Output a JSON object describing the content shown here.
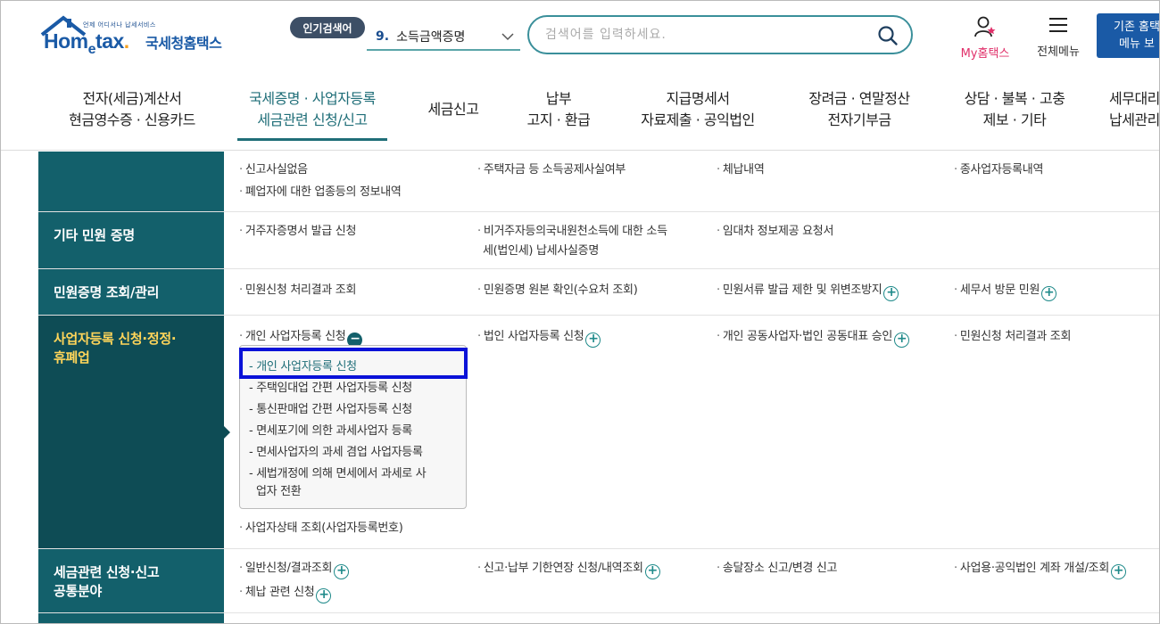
{
  "header": {
    "logo_tagline": "언제 어디서나 납세서비스",
    "logo_word_1": "Hom",
    "logo_word_e": "e",
    "logo_word_2": "tax",
    "logo_word_dot": ".",
    "logo_name": "국세청홈택스",
    "popular_badge": "인기검색어",
    "popular_rank": "9.",
    "popular_term": "소득금액증명",
    "search_placeholder": "검색어를 입력하세요.",
    "my_hometax": "My홈택스",
    "all_menu": "전체메뉴",
    "old_button_line1": "기존 홈택",
    "old_button_line2": "메뉴 보"
  },
  "gnb": [
    {
      "line1": "전자(세금)계산서",
      "line2": "현금영수증 · 신용카드"
    },
    {
      "line1": "국세증명 · 사업자등록",
      "line2": "세금관련 신청/신고"
    },
    {
      "line1": "세금신고",
      "line2": ""
    },
    {
      "line1": "납부",
      "line2": "고지 · 환급"
    },
    {
      "line1": "지급명세서",
      "line2": "자료제출 · 공익법인"
    },
    {
      "line1": "장려금 · 연말정산",
      "line2": "전자기부금"
    },
    {
      "line1": "상담 · 불복 · 고충",
      "line2": "제보 · 기타"
    },
    {
      "line1": "세무대리",
      "line2": "납세관리"
    }
  ],
  "rows": {
    "top": {
      "c1a": "신고사실없음",
      "c1b": "폐업자에 대한 업종등의 정보내역",
      "c2": "주택자금 등 소득공제사실여부",
      "c3": "체납내역",
      "c4": "종사업자등록내역"
    },
    "etc": {
      "title": "기타 민원 증명",
      "c1": "거주자증명서 발급 신청",
      "c2a": "비거주자등의국내원천소득에 대한 소득",
      "c2b": "세(법인세) 납세사실증명",
      "c3": "임대차 정보제공 요청서"
    },
    "manage": {
      "title": "민원증명 조회/관리",
      "c1": "민원신청 처리결과 조회",
      "c2": "민원증명 원본 확인(수요처 조회)",
      "c3": "민원서류 발급 제한 및 위변조방지",
      "c4": "세무서 방문 민원"
    },
    "bizreg": {
      "title_1": "사업자등록 신청·정정·",
      "title_2": "휴폐업",
      "c1": "개인 사업자등록 신청",
      "c2": "법인 사업자등록 신청",
      "c3": "개인 공동사업자·법인 공동대표 승인",
      "c4": "민원신청 처리결과 조회",
      "c5": "사업자상태 조회(사업자등록번호)",
      "submenu": [
        "개인 사업자등록 신청",
        "주택임대업 간편 사업자등록 신청",
        "통신판매업 간편 사업자등록 신청",
        "면세포기에 의한 과세사업자 등록",
        "면세사업자의 과세 겸업 사업자등록",
        "세법개정에 의해 면세에서 과세로 사",
        "업자 전환"
      ]
    },
    "common": {
      "title_1": "세금관련 신청·신고",
      "title_2": "공통분야",
      "c1": "일반신청/결과조회",
      "c1b": "체납 관련 신청",
      "c2": "신고·납부 기한연장 신청/내역조회",
      "c3": "송달장소 신고/변경 신고",
      "c4": "사업용·공익법인 계좌 개설/조회"
    }
  },
  "colors": {
    "brand_blue": "#1a5aa6",
    "teal": "#13606b",
    "active_head": "#0e4c55",
    "active_text": "#ffd55a",
    "highlight": "#0a12d8",
    "my_pink": "#e0306a"
  }
}
